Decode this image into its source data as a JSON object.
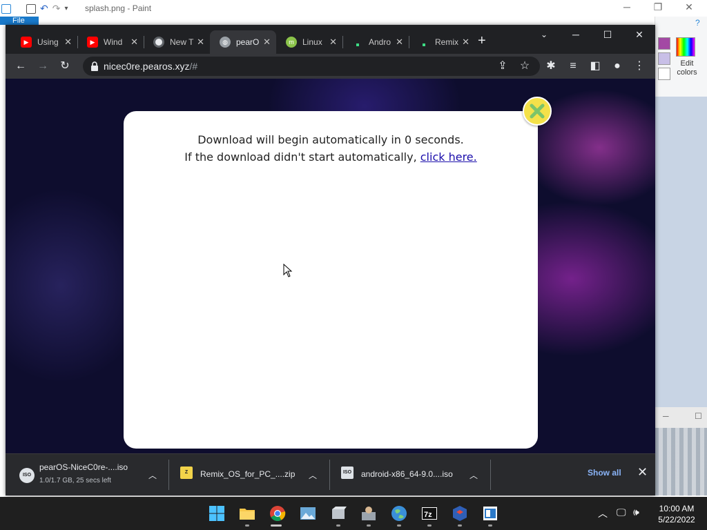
{
  "paint": {
    "title": "splash.png - Paint",
    "file_tab": "File",
    "edit_colors_label": "Edit colors"
  },
  "browser": {
    "tabs": [
      {
        "label": "Using",
        "icon": "youtube-icon",
        "color": "#ff0000"
      },
      {
        "label": "Wind",
        "icon": "youtube-icon",
        "color": "#ff0000"
      },
      {
        "label": "New T",
        "icon": "chrome-icon",
        "color": "#9aa0a6"
      },
      {
        "label": "pearO",
        "icon": "globe-icon",
        "color": "#9aa0a6"
      },
      {
        "label": "Linux",
        "icon": "linux-mint-icon",
        "color": "#8bc34a"
      },
      {
        "label": "Andro",
        "icon": "android-icon",
        "color": "#3ddc84"
      },
      {
        "label": "Remix",
        "icon": "remix-icon",
        "color": "#3ddc84"
      }
    ],
    "address": {
      "host": "nicec0re.pearos.xyz",
      "path": "/#"
    }
  },
  "page": {
    "modal": {
      "line1": "Download will begin automatically in 0 seconds.",
      "line2_prefix": "If the download didn't start automatically,",
      "link": "click here."
    }
  },
  "downloads": {
    "items": [
      {
        "name": "pearOS-NiceC0re-....iso",
        "status": "1.0/1.7 GB, 25 secs left",
        "type": "iso"
      },
      {
        "name": "Remix_OS_for_PC_....zip",
        "status": "",
        "type": "zip"
      },
      {
        "name": "android-x86_64-9.0....iso",
        "status": "",
        "type": "iso"
      }
    ],
    "show_all": "Show all"
  },
  "taskbar": {
    "time": "10:00 AM",
    "date": "5/22/2022",
    "apps": [
      "start-icon",
      "file-explorer-icon",
      "chrome-icon",
      "photos-icon",
      "virtualbox-icon",
      "installer-icon",
      "globe-icon",
      "7zip-icon",
      "virtualbox-cube-icon",
      "notepad-icon"
    ]
  }
}
